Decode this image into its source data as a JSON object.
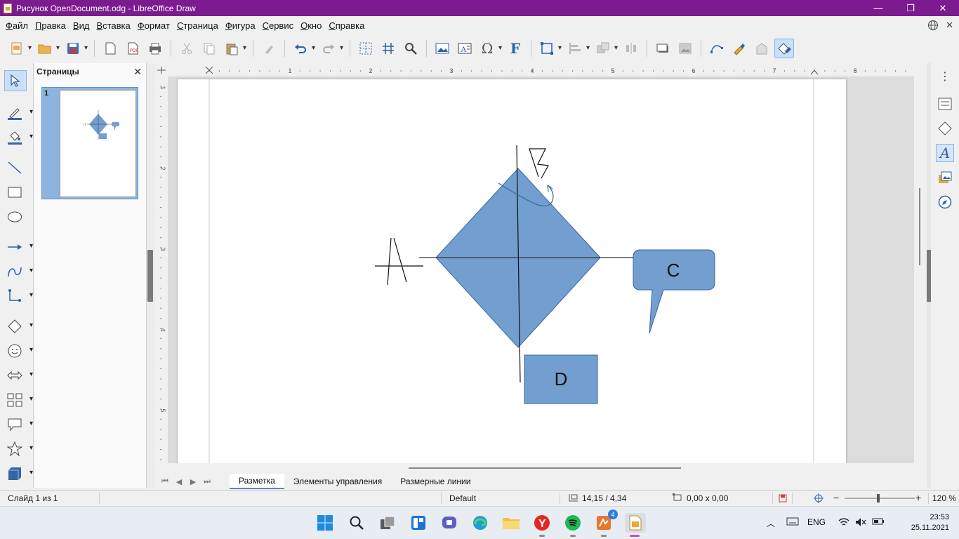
{
  "window": {
    "title": "Рисунок OpenDocument.odg - LibreOffice Draw",
    "controls": [
      "—",
      "❐",
      "✕"
    ]
  },
  "menu": [
    {
      "label": "Файл",
      "key": "Ф",
      "rest": "айл"
    },
    {
      "label": "Правка",
      "key": "П",
      "rest": "равка"
    },
    {
      "label": "Вид",
      "key": "В",
      "rest": "ид"
    },
    {
      "label": "Вставка",
      "key": "В",
      "rest": "ставка"
    },
    {
      "label": "Формат",
      "key": "Ф",
      "rest": "ормат"
    },
    {
      "label": "Страница",
      "key": "С",
      "rest": "траница"
    },
    {
      "label": "Фигура",
      "key": "Ф",
      "rest": "игура"
    },
    {
      "label": "Сервис",
      "key": "С",
      "rest": "ервис"
    },
    {
      "label": "Окно",
      "key": "О",
      "rest": "кно"
    },
    {
      "label": "Справка",
      "key": "С",
      "rest": "правка"
    }
  ],
  "pages_panel": {
    "title": "Страницы",
    "close": "✕",
    "thumb_number": "1"
  },
  "drawing": {
    "label_c": "C",
    "label_d": "D",
    "shape_fill": "#729fcf",
    "shape_stroke": "#3465a4"
  },
  "tabs": {
    "nav": [
      "⏮",
      "◀",
      "▶",
      "⏭"
    ],
    "items": [
      {
        "label": "Разметка",
        "active": true
      },
      {
        "label": "Элементы управления",
        "active": false
      },
      {
        "label": "Размерные линии",
        "active": false
      }
    ]
  },
  "ruler": {
    "h_labels": [
      "1",
      "2",
      "3",
      "4",
      "5",
      "6",
      "7",
      "8"
    ],
    "v_labels": [
      "1",
      "2",
      "3",
      "4",
      "5"
    ]
  },
  "status": {
    "slide": "Слайд 1 из 1",
    "master": "Default",
    "position": "14,15 / 4,34",
    "size": "0,00 x 0,00",
    "zoom": "120 %"
  },
  "taskbar": {
    "lang": "ENG",
    "time": "23:53",
    "date": "25.11.2021",
    "badge": "4"
  }
}
